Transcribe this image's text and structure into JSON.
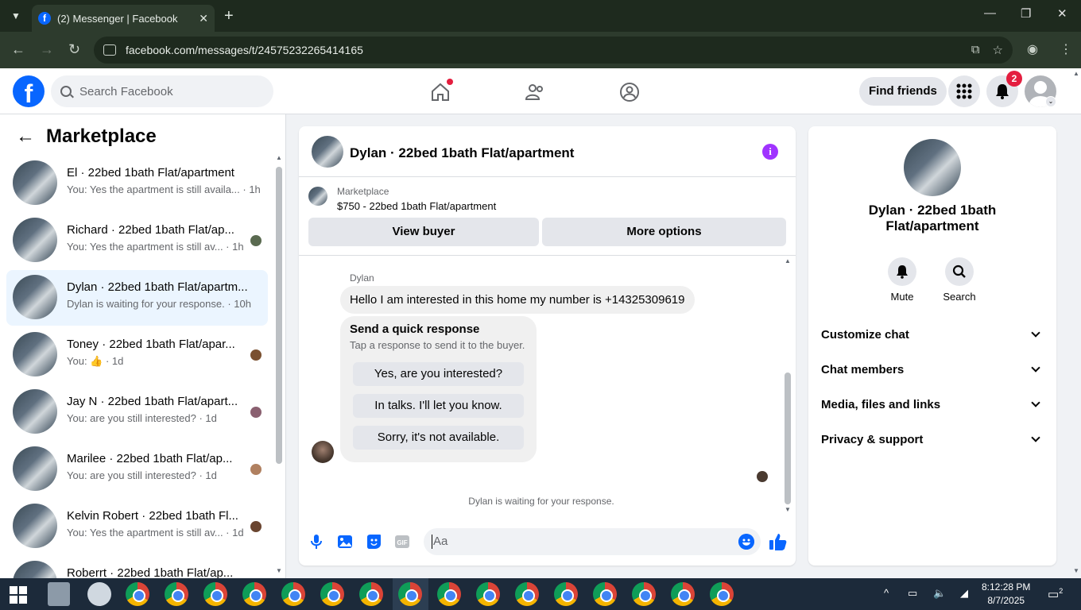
{
  "browser": {
    "tab_title": "(2) Messenger | Facebook",
    "url": "facebook.com/messages/t/24575232265414165"
  },
  "fb_header": {
    "search_placeholder": "Search Facebook",
    "find_friends": "Find friends",
    "notification_count": "2"
  },
  "sidebar": {
    "title": "Marketplace",
    "conversations": [
      {
        "name": "El · 22bed 1bath Flat/apartment",
        "last": "You: Yes the apartment is still availa... · 1h"
      },
      {
        "name": "Richard · 22bed 1bath Flat/ap...",
        "last": "You: Yes the apartment is still av... · 1h"
      },
      {
        "name": "Dylan · 22bed 1bath Flat/apartm...",
        "last": "Dylan is waiting for your response. · 10h"
      },
      {
        "name": "Toney · 22bed 1bath Flat/apar...",
        "last": "You: 👍 · 1d"
      },
      {
        "name": "Jay N · 22bed 1bath Flat/apart...",
        "last": "You: are you still interested? · 1d"
      },
      {
        "name": "Marilee · 22bed 1bath Flat/ap...",
        "last": "You: are you still interested? · 1d"
      },
      {
        "name": "Kelvin Robert · 22bed 1bath Fl...",
        "last": "You: Yes the apartment is still av... · 1d"
      },
      {
        "name": "Roberrt · 22bed 1bath Flat/ap...",
        "last": ""
      }
    ]
  },
  "chat": {
    "title": "Dylan · 22bed 1bath Flat/apartment",
    "marketplace_label": "Marketplace",
    "listing": "$750 - 22bed 1bath Flat/apartment",
    "view_buyer": "View buyer",
    "more_options": "More options",
    "author": "Dylan",
    "message": "Hello I am interested in this home my number is +14325309619",
    "quick_title": "Send a quick response",
    "quick_sub": "Tap a response to send it to the buyer.",
    "quick_responses": [
      "Yes, are you interested?",
      "In talks. I'll let you know.",
      "Sorry, it's not available."
    ],
    "waiting": "Dylan is waiting for your response.",
    "composer_placeholder": "Aa"
  },
  "info_panel": {
    "name": "Dylan · 22bed 1bath Flat/apartment",
    "mute": "Mute",
    "search": "Search",
    "sections": [
      "Customize chat",
      "Chat members",
      "Media, files and links",
      "Privacy & support"
    ]
  },
  "taskbar": {
    "time": "8:12:28 PM",
    "date": "8/7/2025",
    "notif_count": "2"
  },
  "colors": {
    "brand": "#0866ff",
    "active_row": "#ebf5ff",
    "badge": "#e41e3f"
  }
}
